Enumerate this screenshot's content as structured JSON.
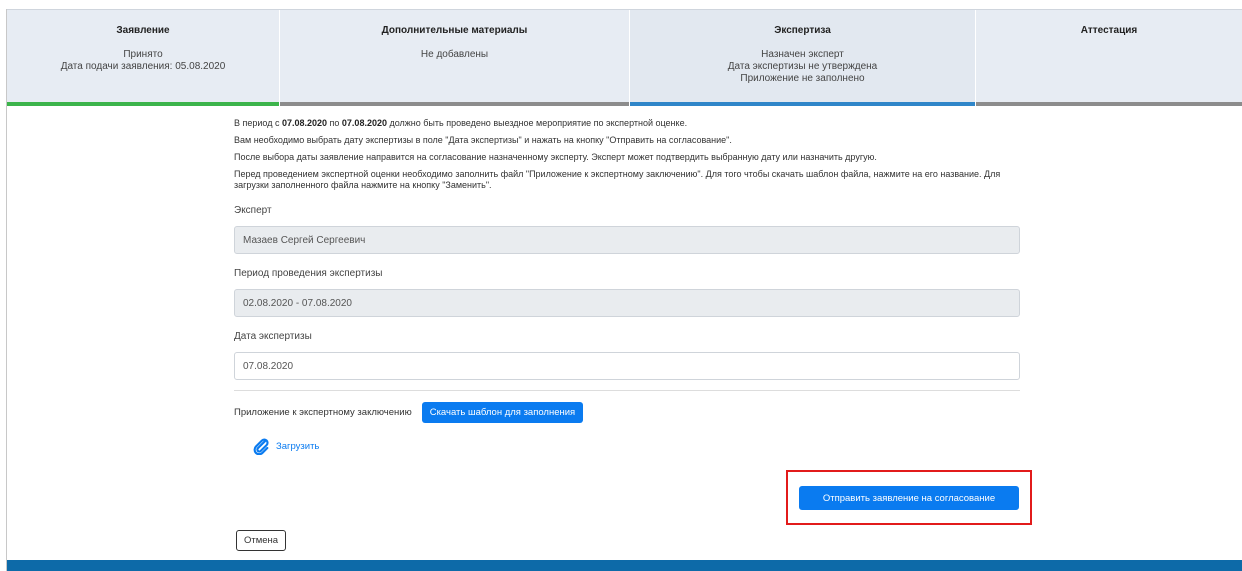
{
  "steps": [
    {
      "title": "Заявление",
      "lines": [
        "Принято",
        "Дата подачи заявления: 05.08.2020"
      ],
      "color": "#3cb44b"
    },
    {
      "title": "Дополнительные материалы",
      "lines": [
        "Не добавлены"
      ],
      "color": "#8c8c8c"
    },
    {
      "title": "Экспертиза",
      "lines": [
        "Назначен эксперт",
        "Дата экспертизы не утверждена",
        "Приложение не заполнено"
      ],
      "color": "#2f86c9"
    },
    {
      "title": "Аттестация",
      "lines": [],
      "color": "#8c8c8c"
    }
  ],
  "info": {
    "p1": {
      "pre": "В период с ",
      "date_from": "07.08.2020",
      "mid": " по ",
      "date_to": "07.08.2020",
      "post": " должно быть проведено выездное мероприятие по экспертной оценке."
    },
    "p2": "Вам необходимо выбрать дату экспертизы в поле \"Дата экспертизы\" и нажать на кнопку \"Отправить на согласование\".",
    "p3": "После выбора даты заявление направится на согласование назначенному эксперту. Эксперт может подтвердить выбранную дату или назначить другую.",
    "p4": "Перед проведением экспертной оценки необходимо заполнить файл \"Приложение к экспертному заключению\". Для того чтобы скачать шаблон файла, нажмите на его название. Для загрузки заполненного файла нажмите на кнопку \"Заменить\"."
  },
  "form": {
    "expert_label": "Эксперт",
    "expert_value": "Мазаев Сергей Сергеевич",
    "period_label": "Период проведения экспертизы",
    "period_value": "02.08.2020 - 07.08.2020",
    "date_label": "Дата экспертизы",
    "date_value": "07.08.2020"
  },
  "attachment": {
    "label": "Приложение к экспертному заключению",
    "download_button": "Скачать шаблон для заполнения",
    "upload_link": "Загрузить",
    "upload_icon": "paperclip-icon"
  },
  "actions": {
    "send_button": "Отправить заявление на согласование",
    "cancel_button": "Отмена"
  },
  "colors": {
    "accent": "#0a7bf0",
    "highlight": "#e21b1b",
    "footer": "#0d6aa8"
  }
}
